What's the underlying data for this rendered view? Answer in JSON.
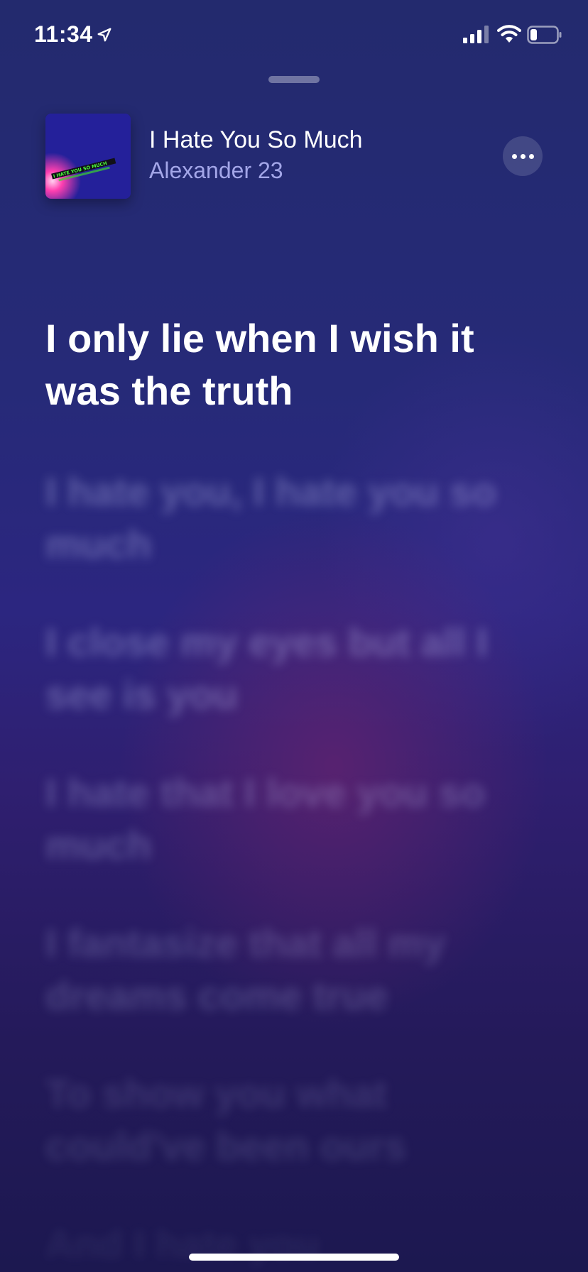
{
  "status_bar": {
    "time": "11:34",
    "icons": [
      "location-arrow-icon",
      "cellular-signal-icon",
      "wifi-icon",
      "battery-icon"
    ],
    "battery_level": 0.25
  },
  "now_playing": {
    "title": "I Hate You So Much",
    "artist": "Alexander 23",
    "artwork_text": "I HATE YOU SO MUCH",
    "more_icon": "ellipsis-icon"
  },
  "lyrics": {
    "active_line": "I only lie when I wish it was the truth",
    "upcoming_lines": [
      "I hate you, I hate you so much",
      "I close my eyes but all I see is you",
      "I hate that I love you so much",
      "I fantasize that all my dreams come true",
      "To show you what could've been ours",
      "And I hate you"
    ]
  },
  "colors": {
    "background_top": "#232a6e",
    "background_bottom": "#1c1850",
    "artist_text": "#a3a6e8",
    "active_lyric": "#ffffff"
  }
}
